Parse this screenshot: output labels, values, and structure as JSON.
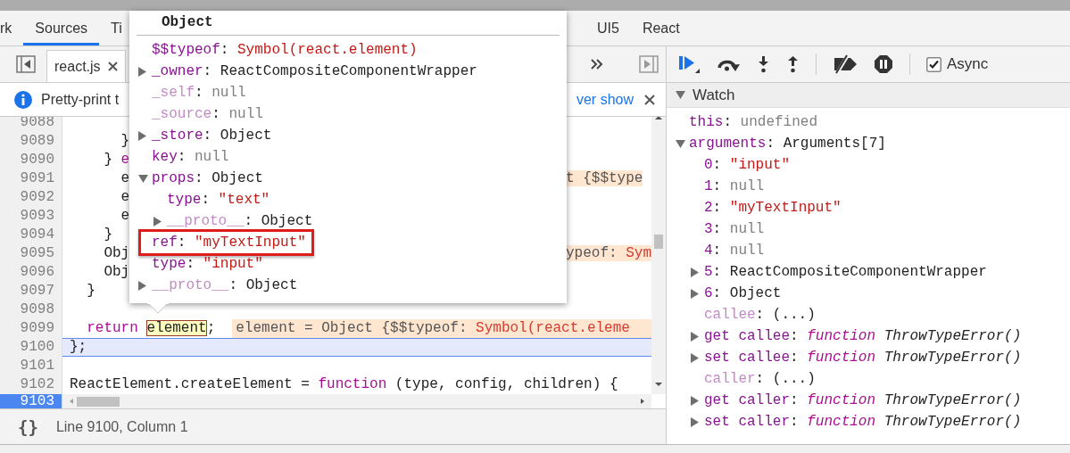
{
  "tabs_left": [
    {
      "label": "rk",
      "selected": false
    },
    {
      "label": "Sources",
      "selected": true
    },
    {
      "label": "Ti",
      "selected": false
    }
  ],
  "tabs_right": [
    {
      "label": "UI5",
      "selected": false
    },
    {
      "label": "React",
      "selected": false
    }
  ],
  "file_tabs": [
    {
      "label": "react.js",
      "selected": true
    }
  ],
  "infobar": {
    "text": "Pretty-print t",
    "link": "ver show"
  },
  "code_lines": [
    {
      "number": "9088",
      "paused": false,
      "breakpoint": false
    },
    {
      "number": "9089",
      "paused": false,
      "breakpoint": false,
      "left": [
        {
          "text": "      }",
          "kind": "plain"
        }
      ]
    },
    {
      "number": "9090",
      "paused": false,
      "breakpoint": false,
      "left": [
        {
          "text": "    } ",
          "kind": "plain"
        },
        {
          "text": "e",
          "kind": "keyword"
        }
      ]
    },
    {
      "number": "9091",
      "paused": false,
      "breakpoint": false,
      "left": [
        {
          "text": "      e",
          "kind": "plain"
        }
      ],
      "inline_value": [
        {
          "text": "t {$$type",
          "kind": "text"
        }
      ]
    },
    {
      "number": "9092",
      "paused": false,
      "breakpoint": false,
      "left": [
        {
          "text": "      e",
          "kind": "plain"
        }
      ]
    },
    {
      "number": "9093",
      "paused": false,
      "breakpoint": false,
      "left": [
        {
          "text": "      e",
          "kind": "plain"
        }
      ]
    },
    {
      "number": "9094",
      "paused": false,
      "breakpoint": false,
      "left": [
        {
          "text": "    }",
          "kind": "plain"
        }
      ]
    },
    {
      "number": "9095",
      "paused": false,
      "breakpoint": false,
      "left": [
        {
          "text": "    Obj",
          "kind": "plain"
        }
      ],
      "inline_value": [
        {
          "text": "ypeof: ",
          "kind": "text"
        },
        {
          "text": "Sym",
          "kind": "string"
        }
      ]
    },
    {
      "number": "9096",
      "paused": false,
      "breakpoint": false,
      "left": [
        {
          "text": "    Obj",
          "kind": "plain"
        }
      ]
    },
    {
      "number": "9097",
      "paused": false,
      "breakpoint": false,
      "left": [
        {
          "text": "  }",
          "kind": "plain"
        }
      ]
    },
    {
      "number": "9098",
      "paused": false,
      "breakpoint": false
    },
    {
      "number": "9099",
      "paused": false,
      "breakpoint": false,
      "code": [
        {
          "text": "  return ",
          "kind": "keyword"
        },
        {
          "text": "element",
          "kind": "match"
        },
        {
          "text": ";",
          "kind": "plain"
        }
      ],
      "inline_value": [
        {
          "text": "element = Object {$$typeof: ",
          "kind": "text"
        },
        {
          "text": "Symbol(react.eleme",
          "kind": "string"
        }
      ]
    },
    {
      "number": "9100",
      "paused": true,
      "breakpoint": false,
      "code": [
        {
          "text": "};",
          "kind": "plain"
        }
      ]
    },
    {
      "number": "9101",
      "paused": false,
      "breakpoint": false
    },
    {
      "number": "9102",
      "paused": false,
      "breakpoint": false,
      "code": [
        {
          "text": "ReactElement.createElement = ",
          "kind": "plain"
        },
        {
          "text": "function",
          "kind": "keyword"
        },
        {
          "text": " (type, config, children) {",
          "kind": "plain"
        }
      ]
    },
    {
      "number": "9103",
      "paused": false,
      "breakpoint": true
    }
  ],
  "status_bar": {
    "format_button": "{}",
    "position": "Line 9100, Column 1"
  },
  "popover": {
    "title": "Object",
    "rows": [
      {
        "key": "$$typeof:",
        "enumerable": true,
        "value": "Symbol(react.element)",
        "kind": "symbol",
        "expandable": false,
        "highlighted": false
      },
      {
        "key": "_owner:",
        "enumerable": true,
        "value": "ReactCompositeComponentWrapper",
        "kind": "object",
        "expandable": true,
        "expanded": false,
        "highlighted": false
      },
      {
        "key": "_self:",
        "enumerable": false,
        "value": "null",
        "kind": "null",
        "expandable": false,
        "highlighted": false
      },
      {
        "key": "_source:",
        "enumerable": false,
        "value": "null",
        "kind": "null",
        "expandable": false,
        "highlighted": false
      },
      {
        "key": "_store:",
        "enumerable": true,
        "value": "Object",
        "kind": "object",
        "expandable": true,
        "expanded": false,
        "highlighted": false
      },
      {
        "key": "key:",
        "enumerable": true,
        "value": "null",
        "kind": "null",
        "expandable": false,
        "highlighted": false
      },
      {
        "key": "props:",
        "enumerable": true,
        "value": "Object",
        "kind": "object",
        "expandable": true,
        "expanded": true,
        "highlighted": false,
        "children": [
          {
            "key": "type:",
            "enumerable": true,
            "value": "\"text\"",
            "kind": "string",
            "expandable": false,
            "highlighted": false
          },
          {
            "key": "__proto__:",
            "enumerable": false,
            "value": "Object",
            "kind": "object",
            "expandable": true,
            "expanded": false,
            "highlighted": false
          }
        ]
      },
      {
        "key": "ref:",
        "enumerable": true,
        "value": "\"myTextInput\"",
        "kind": "string",
        "expandable": false,
        "highlighted": true
      },
      {
        "key": "type:",
        "enumerable": true,
        "value": "\"input\"",
        "kind": "string",
        "expandable": false,
        "highlighted": false
      },
      {
        "key": "__proto__:",
        "enumerable": false,
        "value": "Object",
        "kind": "object",
        "expandable": true,
        "expanded": false,
        "highlighted": false
      }
    ]
  },
  "debugger_toolbar": {
    "async": {
      "label": "Async",
      "checked": true
    }
  },
  "watch": {
    "title": "Watch",
    "expanded": true,
    "items": [
      {
        "key": "this:",
        "enumerable": true,
        "value": "undefined",
        "kind": "undefined",
        "expandable": false
      },
      {
        "key": "arguments:",
        "enumerable": true,
        "value": "Arguments[7]",
        "kind": "object",
        "expandable": true,
        "expanded": true,
        "children": [
          {
            "key": "0:",
            "enumerable": true,
            "value": "\"input\"",
            "kind": "string",
            "expandable": false
          },
          {
            "key": "1:",
            "enumerable": true,
            "value": "null",
            "kind": "null",
            "expandable": false
          },
          {
            "key": "2:",
            "enumerable": true,
            "value": "\"myTextInput\"",
            "kind": "string",
            "expandable": false
          },
          {
            "key": "3:",
            "enumerable": true,
            "value": "null",
            "kind": "null",
            "expandable": false
          },
          {
            "key": "4:",
            "enumerable": true,
            "value": "null",
            "kind": "null",
            "expandable": false
          },
          {
            "key": "5:",
            "enumerable": true,
            "value": "ReactCompositeComponentWrapper",
            "kind": "object",
            "expandable": true,
            "expanded": false
          },
          {
            "key": "6:",
            "enumerable": true,
            "value": "Object",
            "kind": "object",
            "expandable": true,
            "expanded": false
          },
          {
            "key": "callee:",
            "enumerable": false,
            "value": "(...)",
            "kind": "accessor",
            "expandable": false
          },
          {
            "key": "get callee:",
            "enumerable": true,
            "value_keyword": "function",
            "value": "ThrowTypeError()",
            "kind": "function",
            "expandable": true,
            "expanded": false
          },
          {
            "key": "set callee:",
            "enumerable": true,
            "value_keyword": "function",
            "value": "ThrowTypeError()",
            "kind": "function",
            "expandable": true,
            "expanded": false
          },
          {
            "key": "caller:",
            "enumerable": false,
            "value": "(...)",
            "kind": "accessor",
            "expandable": false
          },
          {
            "key": "get caller:",
            "enumerable": true,
            "value_keyword": "function",
            "value": "ThrowTypeError()",
            "kind": "function",
            "expandable": true,
            "expanded": false
          },
          {
            "key": "set caller:",
            "enumerable": true,
            "value_keyword": "function",
            "value": "ThrowTypeError()",
            "kind": "function",
            "expandable": true,
            "expanded": false
          }
        ]
      }
    ]
  }
}
